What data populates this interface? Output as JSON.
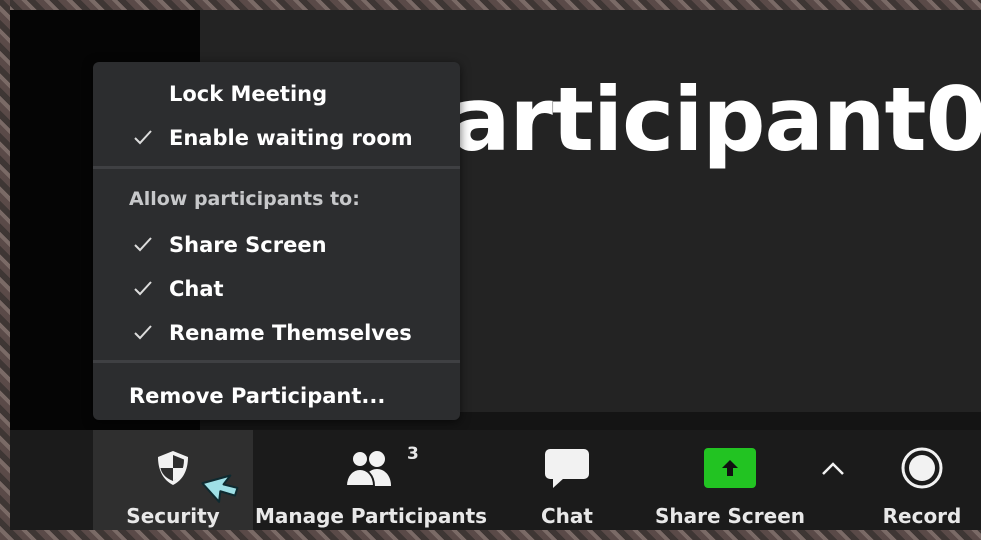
{
  "video": {
    "participant_name": "Participant0"
  },
  "security_menu": {
    "items_top": [
      {
        "label": "Lock Meeting",
        "checked": false
      },
      {
        "label": "Enable waiting room",
        "checked": true
      }
    ],
    "section_heading": "Allow participants to:",
    "permissions": [
      {
        "label": "Share Screen",
        "checked": true
      },
      {
        "label": "Chat",
        "checked": true
      },
      {
        "label": "Rename Themselves",
        "checked": true
      }
    ],
    "remove_participant": "Remove Participant..."
  },
  "toolbar": {
    "security": {
      "label": "Security",
      "icon": "shield-icon"
    },
    "participants": {
      "label": "Manage Participants",
      "count": "3",
      "icon": "people-icon"
    },
    "chat": {
      "label": "Chat",
      "icon": "chat-bubble-icon"
    },
    "share_screen": {
      "label": "Share Screen",
      "icon": "share-arrow-icon",
      "accent": "#22c322"
    },
    "share_options": {
      "icon": "caret-up-icon"
    },
    "record": {
      "label": "Record",
      "icon": "record-icon"
    }
  }
}
